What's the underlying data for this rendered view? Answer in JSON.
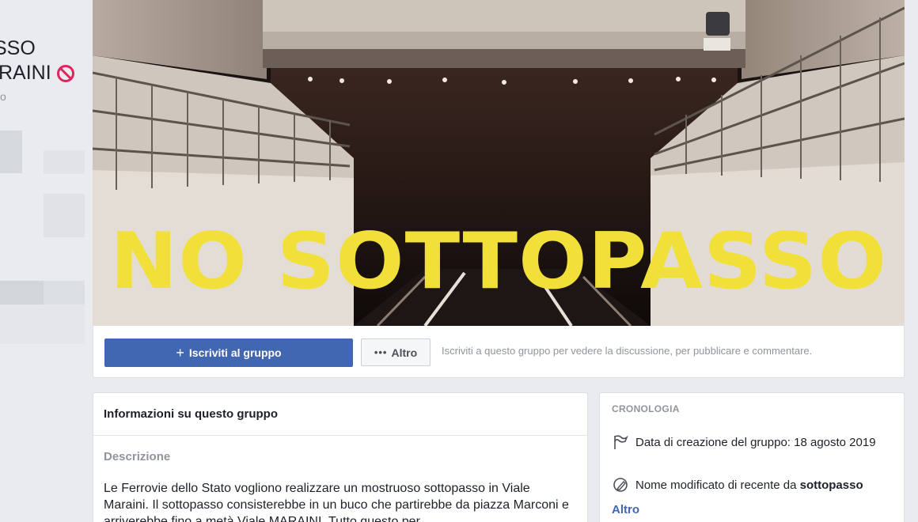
{
  "sidebar": {
    "group_name_line1": "SSO",
    "group_name_line2": "RAINI",
    "group_sub": "o"
  },
  "cover": {
    "banner_text": "NO SOTTOPASSO"
  },
  "action_bar": {
    "join_plus": "+",
    "join_label": "Iscriviti al gruppo",
    "more_dots": "•••",
    "more_label": "Altro",
    "hint": "Iscriviti a questo gruppo per vedere la discussione, per pubblicare e commentare."
  },
  "info": {
    "title": "Informazioni su questo gruppo",
    "description_label": "Descrizione",
    "description": "Le Ferrovie dello Stato vogliono realizzare un mostruoso sottopasso in Viale Maraini. Il sottopasso consisterebbe in un buco che partirebbe da piazza Marconi e arriverebbe fino a metà Viale MARAINI. Tutto questo per"
  },
  "timeline": {
    "title": "CRONOLOGIA",
    "created": "Data di creazione del gruppo: 18 agosto 2019",
    "renamed_prefix": "Nome modificato di recente da ",
    "renamed_by": "sottopasso",
    "more_link": "Altro"
  },
  "colors": {
    "primary_button": "#4267b2",
    "banner_yellow": "#f2e03a",
    "page_bg": "#e9ebee",
    "ban_icon": "#e0245e"
  },
  "icons": [
    "ban-icon",
    "flag-icon",
    "pencil-icon"
  ]
}
